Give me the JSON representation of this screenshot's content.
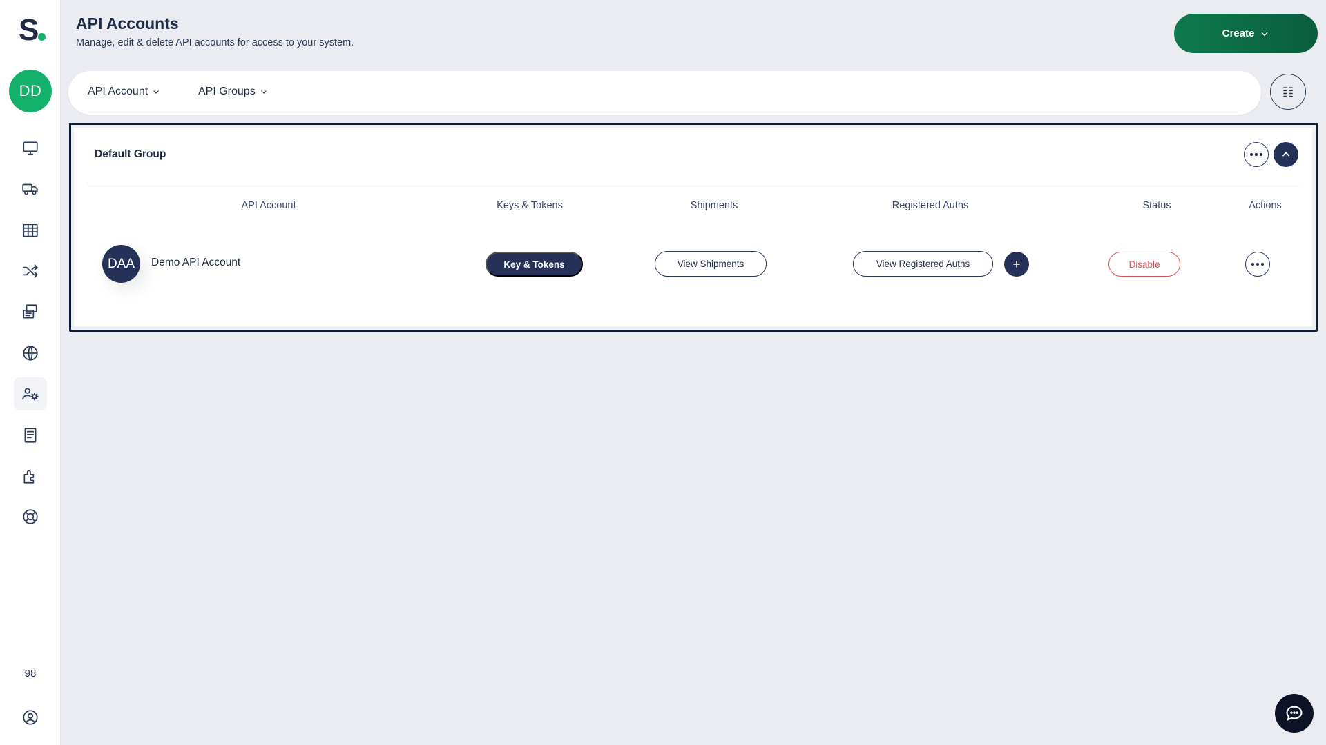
{
  "app": {
    "logo_text": "S",
    "brand_color": "#13b26b"
  },
  "user": {
    "initials": "DD"
  },
  "sidebar": {
    "items": [
      {
        "icon": "monitor-icon",
        "label": "Dashboard"
      },
      {
        "icon": "truck-icon",
        "label": "Shipments"
      },
      {
        "icon": "grid-icon",
        "label": "Tables"
      },
      {
        "icon": "shuffle-icon",
        "label": "Routing"
      },
      {
        "icon": "printer-icon",
        "label": "Printing"
      },
      {
        "icon": "globe-icon",
        "label": "Global"
      },
      {
        "icon": "users-gear-icon",
        "label": "API Accounts",
        "active": true
      },
      {
        "icon": "book-icon",
        "label": "Docs"
      },
      {
        "icon": "puzzle-icon",
        "label": "Integrations"
      },
      {
        "icon": "lifebuoy-icon",
        "label": "Support"
      }
    ],
    "version": "98",
    "profile_icon": "user-circle-icon"
  },
  "header": {
    "title": "API Accounts",
    "subtitle": "Manage, edit & delete API accounts for access to your system.",
    "create_label": "Create"
  },
  "filters": {
    "api_account_label": "API Account",
    "api_groups_label": "API Groups"
  },
  "group": {
    "title": "Default Group",
    "columns": {
      "api_account": "API Account",
      "keys_tokens": "Keys & Tokens",
      "shipments": "Shipments",
      "registered_auths": "Registered Auths",
      "status": "Status",
      "actions": "Actions"
    },
    "rows": [
      {
        "initials": "DAA",
        "name": "Demo API Account",
        "keys_button": "Key & Tokens",
        "shipments_button": "View Shipments",
        "auths_button": "View Registered Auths",
        "status_button": "Disable"
      }
    ]
  },
  "colors": {
    "accent_dark": "#253157",
    "create_green": "#0e7a4e",
    "danger": "#e05252",
    "background": "#eaecf1"
  }
}
